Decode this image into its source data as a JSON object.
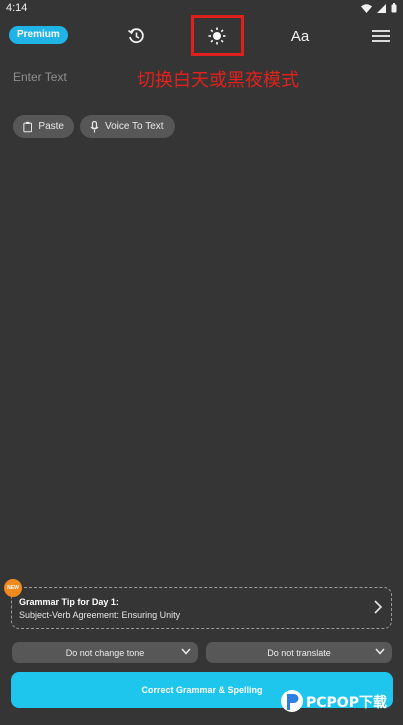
{
  "status_bar": {
    "time": "4:14"
  },
  "toolbar": {
    "premium_label": "Premium",
    "font_size_label": "Aa"
  },
  "editor": {
    "placeholder": "Enter Text"
  },
  "annotation": {
    "text": "切换白天或黑夜模式",
    "color": "#e2211c"
  },
  "actions": {
    "paste_label": "Paste",
    "voice_label": "Voice To Text"
  },
  "tip": {
    "badge": "NEW",
    "title": "Grammar Tip for Day 1:",
    "subtitle": "Subject-Verb Agreement: Ensuring Unity"
  },
  "options": {
    "tone": "Do not change tone",
    "translate": "Do not translate"
  },
  "cta": {
    "label": "Correct Grammar & Spelling"
  },
  "watermark": {
    "text": "PCPOP下载"
  },
  "colors": {
    "accent": "#1ec5ec",
    "background": "#353535",
    "badge": "#f0891e"
  }
}
